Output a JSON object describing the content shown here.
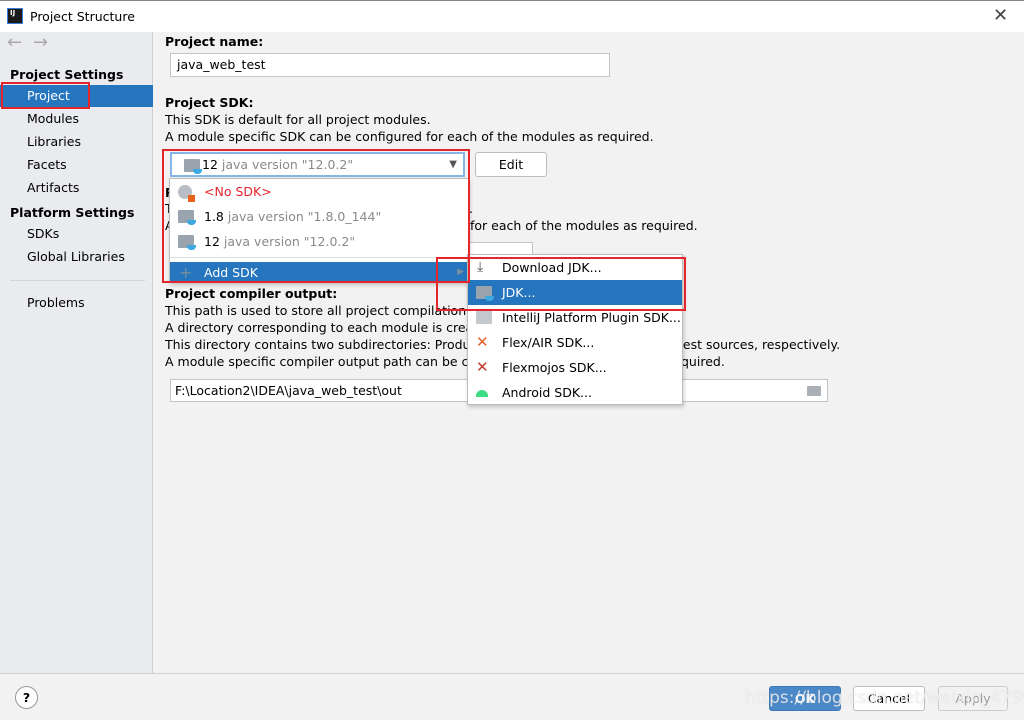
{
  "window": {
    "title": "Project Structure",
    "app_icon": "intellij-icon",
    "close_icon": "close-icon"
  },
  "sidebar": {
    "nav": {
      "back": "arrow-left-icon",
      "forward": "arrow-right-icon"
    },
    "project_settings_header": "Project Settings",
    "project_items": [
      {
        "label": "Project",
        "selected": true
      },
      {
        "label": "Modules"
      },
      {
        "label": "Libraries"
      },
      {
        "label": "Facets"
      },
      {
        "label": "Artifacts"
      }
    ],
    "platform_settings_header": "Platform Settings",
    "platform_items": [
      {
        "label": "SDKs"
      },
      {
        "label": "Global Libraries"
      }
    ],
    "problems": "Problems"
  },
  "main": {
    "project_name_label": "Project name:",
    "project_name_value": "java_web_test",
    "sdk_label": "Project SDK:",
    "sdk_desc1": "This SDK is default for all project modules.",
    "sdk_desc2": "A module specific SDK can be configured for each of the modules as required.",
    "sdk_selected": {
      "version": "12",
      "detail": "java version \"12.0.2\""
    },
    "edit_button": "Edit",
    "lang_fragments": {
      "title_start": "P",
      "line1_start": "T",
      "line1_end": ".",
      "line2_start": "A",
      "line2_end": "for each of the modules as required."
    },
    "compiler_label": "Project compiler output:",
    "compiler_lines": [
      "This path is used to store all project compilation res",
      "A directory corresponding to each module is create",
      "This directory contains two subdirectories: Productio",
      "A module specific compiler output path can be conf"
    ],
    "compiler_line_ends": [
      "test sources, respectively.",
      "quired."
    ],
    "compiler_output_value": "F:\\Location2\\IDEA\\java_web_test\\out"
  },
  "sdk_dropdown": {
    "items": [
      {
        "label": "<No SDK>",
        "color": "#e4262c",
        "icon": "no-sdk-globe-icon"
      },
      {
        "version": "1.8",
        "detail": "java version \"1.8.0_144\"",
        "icon": "jdk-folder-icon"
      },
      {
        "version": "12",
        "detail": "java version \"12.0.2\"",
        "icon": "jdk-folder-icon"
      }
    ],
    "add_sdk": "Add SDK"
  },
  "add_sdk_submenu": [
    {
      "label": "Download JDK...",
      "icon": "download-icon"
    },
    {
      "label": "JDK...",
      "icon": "jdk-folder-icon",
      "selected": true
    },
    {
      "label": "IntelliJ Platform Plugin SDK...",
      "icon": "plugin-sdk-icon"
    },
    {
      "label": "Flex/AIR SDK...",
      "icon": "flex-icon"
    },
    {
      "label": "Flexmojos SDK...",
      "icon": "flexmojos-icon"
    },
    {
      "label": "Android SDK...",
      "icon": "android-icon"
    }
  ],
  "footer": {
    "help": "?",
    "ok": "OK",
    "cancel": "Cancel",
    "apply": "Apply"
  },
  "watermark": "https://blog.csdn.net/weixin_4799211",
  "colors": {
    "accent": "#2675bf",
    "highlight_box": "#e4262c"
  }
}
